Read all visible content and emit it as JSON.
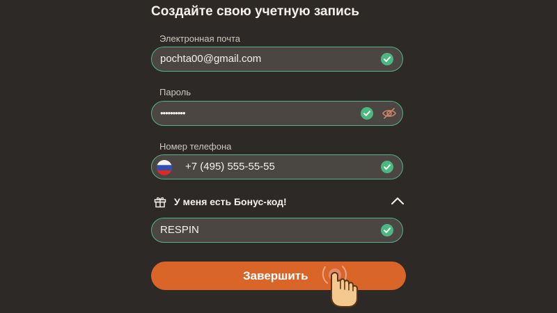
{
  "form": {
    "title": "Создайте свою учетную запись",
    "email": {
      "label": "Электронная почта",
      "value": "pochta00@gmail.com",
      "status": "valid"
    },
    "password": {
      "label": "Пароль",
      "value": "••••••••••",
      "status": "valid"
    },
    "phone": {
      "label": "Номер телефона",
      "value": "+7 (495) 555-55-55",
      "country_flag": "flag-ru-icon",
      "status": "valid"
    },
    "bonus": {
      "toggle_label": "У меня есть Бонус-код!",
      "expanded": true,
      "code": "RESPIN",
      "status": "valid"
    },
    "submit_label": "Завершить"
  },
  "icons": {
    "check": "check-circle-icon",
    "password_visibility": "eye-off-icon",
    "gift": "gift-icon",
    "chevron": "chevron-up-icon",
    "cursor": "hand-cursor-icon"
  },
  "colors": {
    "background": "#2d2927",
    "field_background": "#4c4643",
    "field_border_valid": "#56b287",
    "check": "#4bb882",
    "accent_button": "#d96529",
    "eye_icon": "#c9856b"
  }
}
